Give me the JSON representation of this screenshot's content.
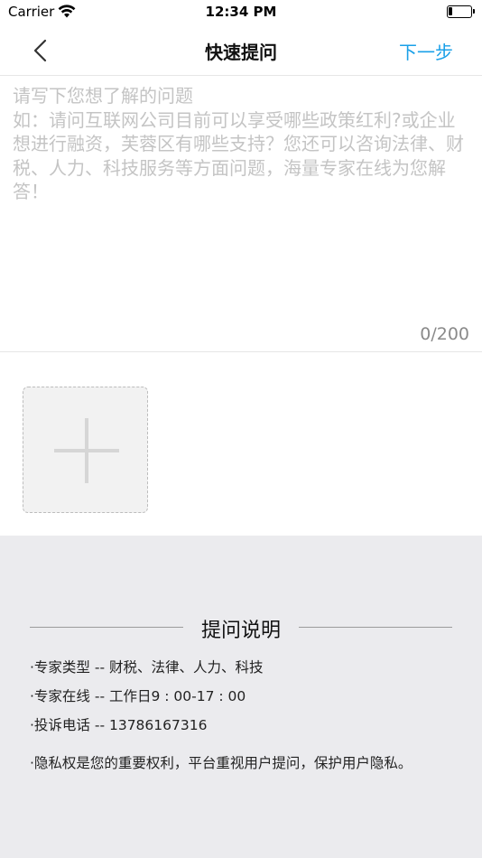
{
  "status_bar": {
    "carrier": "Carrier",
    "time": "12:34 PM"
  },
  "nav": {
    "title": "快速提问",
    "next_label": "下一步",
    "accent_color": "#1aa0e8"
  },
  "question": {
    "value": "",
    "placeholder": "请写下您想了解的问题\n如：请问互联网公司目前可以享受哪些政策红利?或企业想进行融资，芙蓉区有哪些支持？您还可以咨询法律、财税、人力、科技服务等方面问题，海量专家在线为您解答！",
    "count": "0/200"
  },
  "notes": {
    "title": "提问说明",
    "items": [
      "·专家类型 -- 财税、法律、人力、科技",
      "·专家在线 -- 工作日9 : 00-17 : 00",
      "·投诉电话 -- 13786167316",
      "·隐私权是您的重要权利，平台重视用户提问，保护用户隐私。"
    ]
  }
}
